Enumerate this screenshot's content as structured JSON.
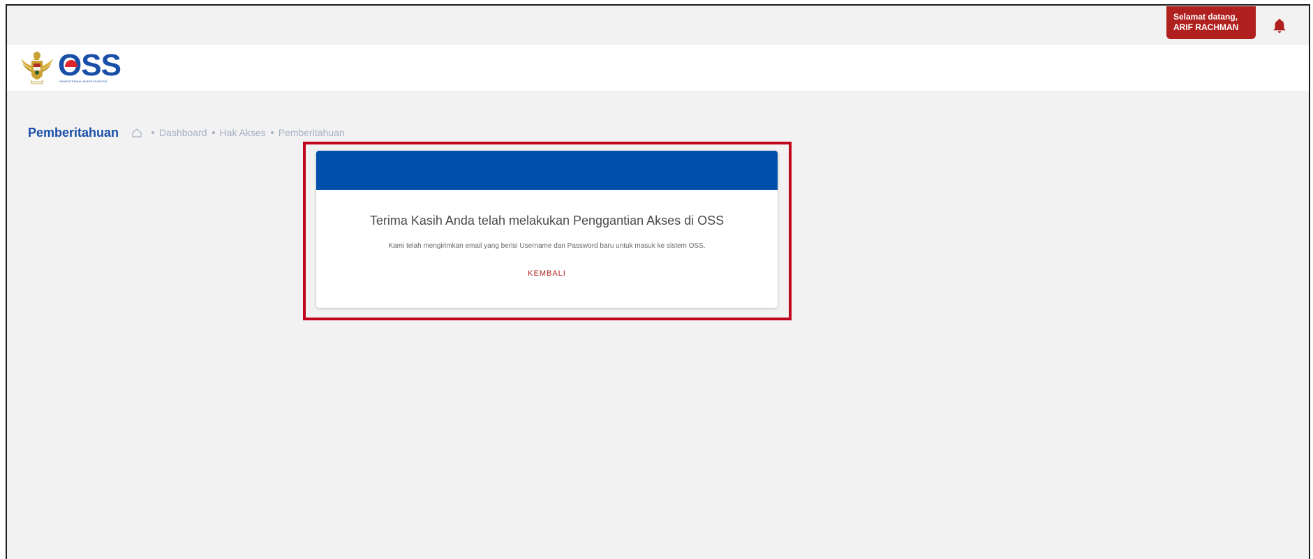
{
  "topbar": {
    "welcome_line1": "Selamat datang,",
    "welcome_line2": "ARIF RACHMAN",
    "notification_icon": "bell-icon",
    "accent_color": "#b0201e"
  },
  "header": {
    "emblem_icon": "garuda-emblem-icon",
    "logo_text": "OSS",
    "logo_subtitle": "KEMENTERIAN INVESTASI/BKPM"
  },
  "page": {
    "title": "Pemberitahuan",
    "breadcrumb": {
      "home_icon": "home-icon",
      "items": [
        "Dashboard",
        "Hak Akses",
        "Pemberitahuan"
      ]
    }
  },
  "card": {
    "header_color": "#004fab",
    "title": "Terima Kasih Anda telah melakukan Penggantian Akses di OSS",
    "message": "Kami telah mengirimkan email yang berisi Username dan Password baru untuk masuk ke sistem OSS.",
    "button_label": "KEMBALI"
  }
}
